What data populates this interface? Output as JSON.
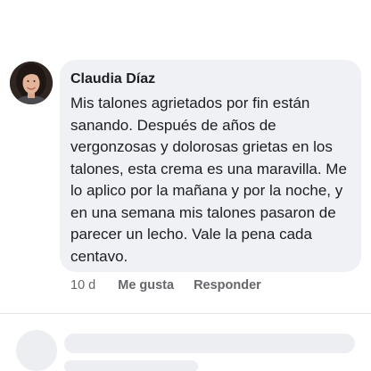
{
  "comment": {
    "author": "Claudia Díaz",
    "text": "Mis talones agrietados por fin están sanando. Después de años de vergonzosas y dolorosas grietas en los talones, esta crema es una maravilla. Me lo aplico por la mañana y por la noche, y en una semana mis talones pasaron de parecer un lecho. Vale la pena cada centavo.",
    "time": "10 d",
    "like_label": "Me gusta",
    "reply_label": "Responder"
  },
  "colors": {
    "bubble_bg": "#eff1f4",
    "text_primary": "#1c1e21",
    "text_secondary": "#65676b",
    "skeleton": "#eceef1"
  },
  "icons": {
    "avatar": "profile-photo"
  }
}
